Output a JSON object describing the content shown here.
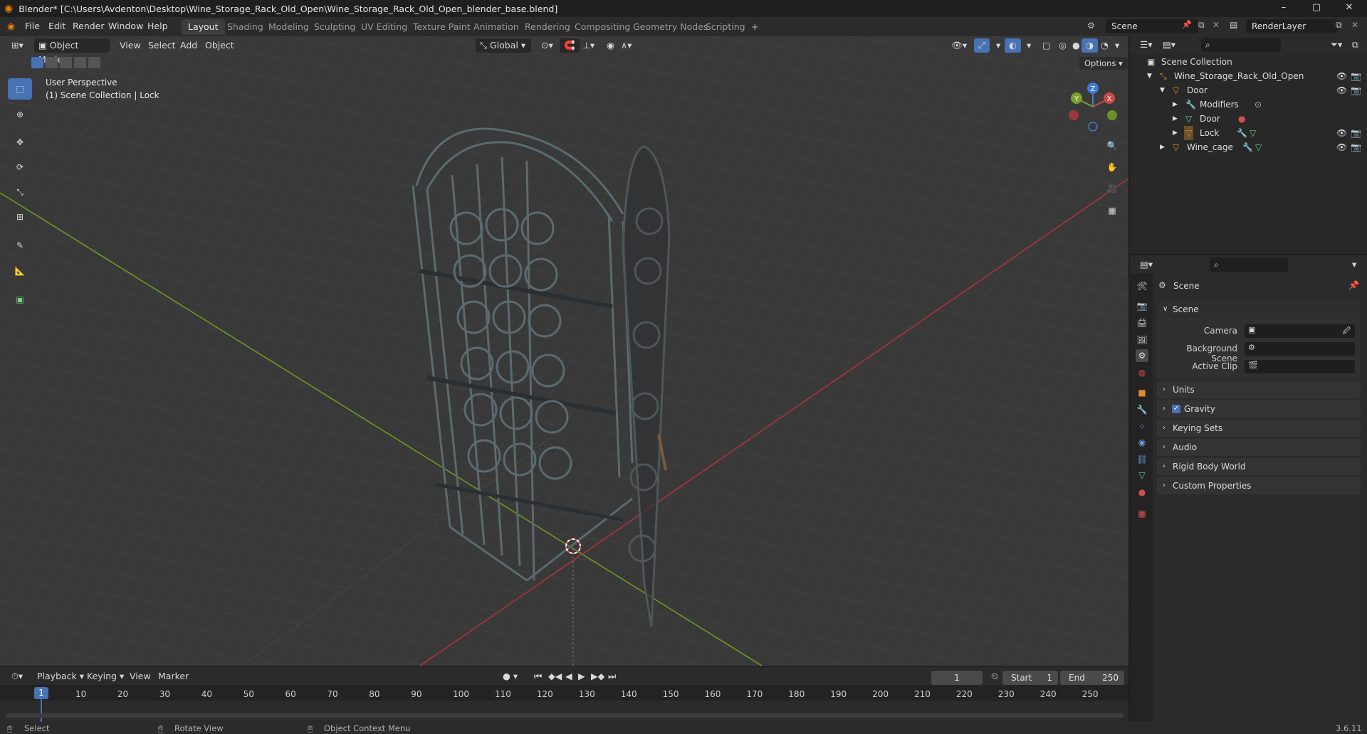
{
  "window": {
    "title": "Blender* [C:\\Users\\Avdenton\\Desktop\\Wine_Storage_Rack_Old_Open\\Wine_Storage_Rack_Old_Open_blender_base.blend]",
    "minimize": "–",
    "maximize": "▢",
    "close": "✕"
  },
  "menu": {
    "items": [
      "File",
      "Edit",
      "Render",
      "Window",
      "Help"
    ]
  },
  "workspaces": {
    "tabs": [
      "Layout",
      "Shading",
      "Modeling",
      "Sculpting",
      "UV Editing",
      "Texture Paint",
      "Animation",
      "Rendering",
      "Compositing",
      "Geometry Nodes",
      "Scripting"
    ],
    "add": "+"
  },
  "scene_selector": {
    "value": "Scene"
  },
  "view_layer": {
    "value": "RenderLayer"
  },
  "viewport_header": {
    "mode": "Object Mode",
    "menus": [
      "View",
      "Select",
      "Add",
      "Object"
    ],
    "orientation": "Global",
    "options": "Options"
  },
  "viewport": {
    "perspective": "User Perspective",
    "collection_info": "(1) Scene Collection | Lock",
    "gizmo": {
      "x": "X",
      "y": "Y",
      "z": "Z"
    }
  },
  "outliner": {
    "root": "Scene Collection",
    "items": [
      {
        "label": "Wine_Storage_Rack_Old_Open"
      },
      {
        "label": "Door"
      },
      {
        "label": "Modifiers"
      },
      {
        "label": "Door"
      },
      {
        "label": "Lock"
      },
      {
        "label": "Wine_cage"
      }
    ]
  },
  "properties": {
    "context_title": "Scene",
    "scene_panel": "Scene",
    "fields": {
      "camera": "Camera",
      "background_scene": "Background Scene",
      "active_clip": "Active Clip"
    },
    "panels": [
      "Units",
      "Gravity",
      "Keying Sets",
      "Audio",
      "Rigid Body World",
      "Custom Properties"
    ],
    "gravity_checked": true
  },
  "timeline": {
    "menus": [
      "Playback",
      "Keying",
      "View",
      "Marker"
    ],
    "current_frame": "1",
    "start_label": "Start",
    "start_value": "1",
    "end_label": "End",
    "end_value": "250",
    "ruler": [
      "10",
      "20",
      "30",
      "40",
      "50",
      "60",
      "70",
      "80",
      "90",
      "100",
      "110",
      "120",
      "130",
      "140",
      "150",
      "160",
      "170",
      "180",
      "190",
      "200",
      "210",
      "220",
      "230",
      "240",
      "250"
    ],
    "playhead": "1"
  },
  "statusbar": {
    "select": "Select",
    "rotate": "Rotate View",
    "context": "Object Context Menu",
    "version": "3.6.11"
  },
  "colors": {
    "accent": "#4772b3",
    "x_axis": "#c84a4a",
    "y_axis": "#7aa22b",
    "z_axis": "#3f7bd6",
    "object_orange": "#e38b2c",
    "mesh_green": "#5fcf8f"
  }
}
